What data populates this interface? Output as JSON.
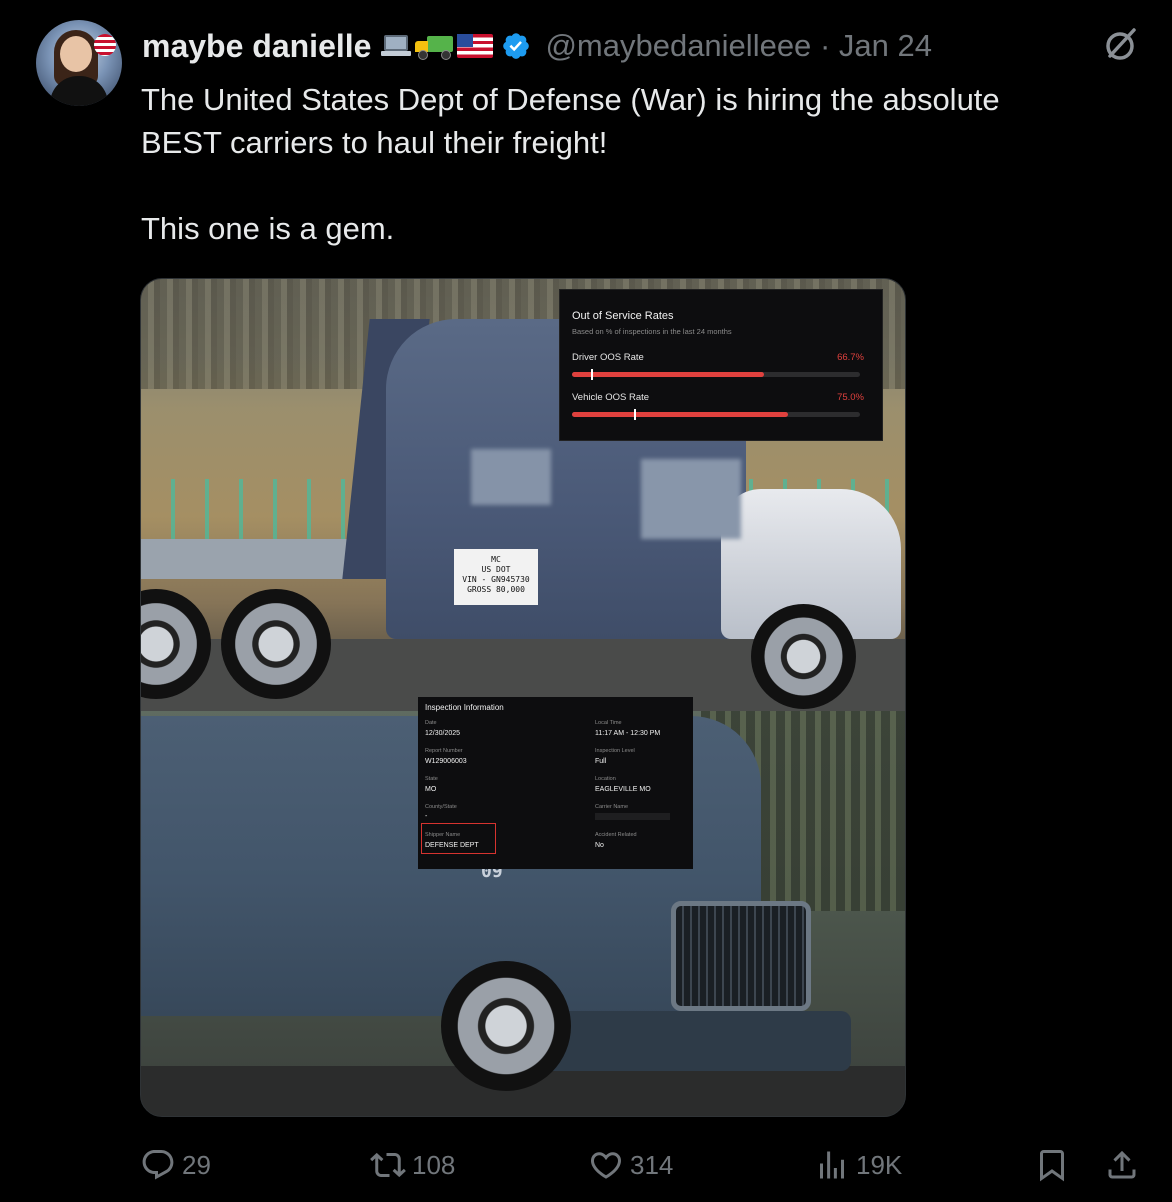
{
  "post": {
    "author_name": "maybe danielle",
    "author_emojis": [
      "laptop-emoji",
      "truck-emoji",
      "us-flag-emoji"
    ],
    "handle": "@maybedanielleee",
    "separator": "·",
    "date": "Jan 24",
    "text": "The United States Dept of Defense (War) is hiring the absolute\nBEST carriers to haul their freight!\n\nThis one is a gem."
  },
  "media": {
    "dot_plate_lines": [
      "MC",
      "US DOT",
      "VIN - GN945730",
      "GROSS 80,000"
    ],
    "oos_panel": {
      "title": "Out of Service Rates",
      "subtitle": "Based on % of inspections in the last 24 months",
      "driver_label": "Driver OOS Rate",
      "driver_value": "66.7%",
      "driver_fraction": 0.667,
      "vehicle_label": "Vehicle OOS Rate",
      "vehicle_value": "75.0%",
      "vehicle_fraction": 0.75
    },
    "inspection_panel": {
      "title": "Inspection Information",
      "date_label": "Date",
      "date_value": "12/30/2025",
      "local_time_label": "Local Time",
      "local_time_value": "11:17 AM - 12:30 PM",
      "report_label": "Report Number",
      "report_value": "W129006003",
      "level_label": "Inspection Level",
      "level_value": "Full",
      "state_label": "State",
      "state_value": "MO",
      "location_label": "Location",
      "location_value": "EAGLEVILLE MO",
      "county_label": "County/State",
      "county_value": "-",
      "carrier_label": "Carrier Name",
      "shipper_label": "Shipper Name",
      "shipper_value": "DEFENSE DEPT",
      "accident_label": "Accident Related",
      "accident_value": "No"
    },
    "truck2_number": "09"
  },
  "actions": {
    "replies": "29",
    "reposts": "108",
    "likes": "314",
    "views": "19K"
  },
  "colors": {
    "background": "#000000",
    "text": "#e7e9ea",
    "muted": "#71767b",
    "verified": "#1d9bf0",
    "oos_red": "#e0413e"
  }
}
